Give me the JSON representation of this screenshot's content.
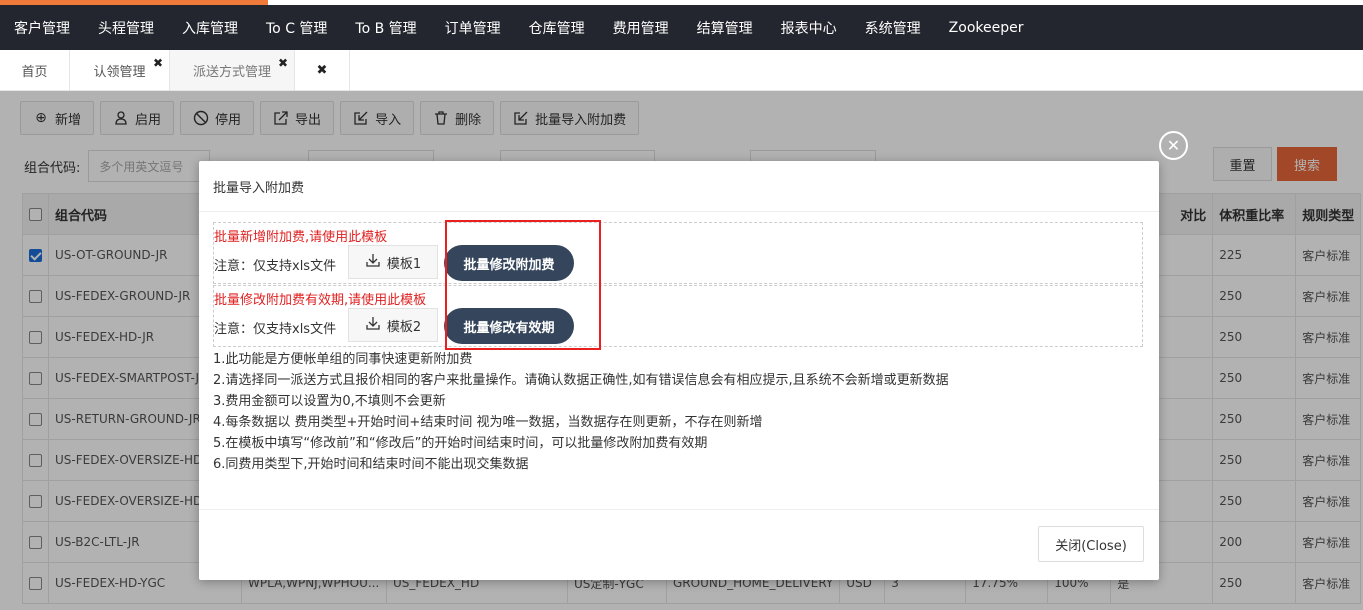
{
  "nav": [
    "客户管理",
    "头程管理",
    "入库管理",
    "To C 管理",
    "To B 管理",
    "订单管理",
    "仓库管理",
    "费用管理",
    "结算管理",
    "报表中心",
    "系统管理",
    "Zookeeper"
  ],
  "tabs": [
    "首页",
    "认领管理",
    "派送方式管理"
  ],
  "toolbar": {
    "add": "新增",
    "enable": "启用",
    "disable": "停用",
    "export": "导出",
    "import": "导入",
    "delete": "删除",
    "batch_import": "批量导入附加费"
  },
  "filters": {
    "group_code_label": "组合代码:",
    "group_code_placeholder": "多个用英文逗号"
  },
  "buttons": {
    "reset": "重置",
    "search": "搜索"
  },
  "table": {
    "headers": [
      "组合代码",
      "对比",
      "体积重比率",
      "规则类型"
    ],
    "rows": [
      {
        "code": "US-OT-GROUND-JR",
        "ratio": "225",
        "rule": "客户标准",
        "checked": true
      },
      {
        "code": "US-FEDEX-GROUND-JR",
        "ratio": "250",
        "rule": "客户标准",
        "checked": false
      },
      {
        "code": "US-FEDEX-HD-JR",
        "ratio": "250",
        "rule": "客户标准",
        "checked": false
      },
      {
        "code": "US-FEDEX-SMARTPOST-JR",
        "ratio": "250",
        "rule": "客户标准",
        "checked": false
      },
      {
        "code": "US-RETURN-GROUND-JR",
        "ratio": "250",
        "rule": "客户标准",
        "checked": false
      },
      {
        "code": "US-FEDEX-OVERSIZE-HD-",
        "ratio": "250",
        "rule": "客户标准",
        "checked": false
      },
      {
        "code": "US-FEDEX-OVERSIZE-HD-",
        "ratio": "250",
        "rule": "客户标准",
        "checked": false
      },
      {
        "code": "US-B2C-LTL-JR",
        "ratio": "200",
        "rule": "客户标准",
        "checked": false
      },
      {
        "code": "US-FEDEX-HD-YGC",
        "ratio": "250",
        "rule": "客户标准",
        "checked": false
      }
    ],
    "last_row_extra": {
      "warehouses": "WPLA,WPNJ,WPHOU...",
      "carrier": "US_FEDEX_HD",
      "customer": "US定制-YGC",
      "service": "GROUND_HOME_DELIVERY",
      "currency": "USD",
      "num": "3",
      "pct": "17.75%",
      "pct2": "100%",
      "flag": "是"
    }
  },
  "modal": {
    "title": "批量导入附加费",
    "block1": {
      "red": "批量新增附加费,请使用此模板",
      "note": "注意：仅支持xls文件",
      "template": "模板1",
      "action": "批量修改附加费"
    },
    "block2": {
      "red": "批量修改附加费有效期,请使用此模板",
      "note": "注意：仅支持xls文件",
      "template": "模板2",
      "action": "批量修改有效期"
    },
    "instructions": [
      "1.此功能是方便帐单组的同事快速更新附加费",
      "2.请选择同一派送方式且报价相同的客户来批量操作。请确认数据正确性,如有错误信息会有相应提示,且系统不会新增或更新数据",
      "3.费用金额可以设置为0,不填则不会更新",
      "4.每条数据以 费用类型+开始时间+结束时间 视为唯一数据，当数据存在则更新，不存在则新增",
      "5.在模板中填写“修改前”和“修改后”的开始时间结束时间，可以批量修改附加费有效期",
      "6.同费用类型下,开始时间和结束时间不能出现交集数据"
    ],
    "close": "关闭(Close)"
  },
  "colors": {
    "accent": "#e9673a",
    "nav_bg": "#23262e",
    "dark_button": "#35465c",
    "highlight": "#e82020"
  }
}
